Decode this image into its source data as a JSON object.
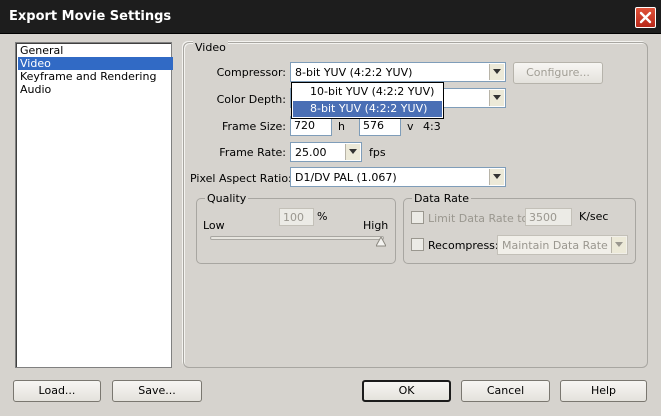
{
  "window": {
    "title": "Export Movie Settings",
    "close_icon": "close-icon"
  },
  "sidebar": {
    "items": [
      {
        "label": "General",
        "selected": false
      },
      {
        "label": "Video",
        "selected": true
      },
      {
        "label": "Keyframe and Rendering",
        "selected": false
      },
      {
        "label": "Audio",
        "selected": false
      }
    ]
  },
  "video": {
    "legend": "Video",
    "compressor": {
      "label": "Compressor:",
      "value": "8-bit YUV (4:2:2 YUV)",
      "configure_label": "Configure...",
      "options": [
        "10-bit YUV (4:2:2 YUV)",
        "8-bit YUV (4:2:2 YUV)"
      ],
      "selected_option": "8-bit YUV (4:2:2 YUV)"
    },
    "color_depth": {
      "label": "Color Depth:",
      "value": ""
    },
    "frame_size": {
      "label": "Frame Size:",
      "width": "720",
      "h_label": "h",
      "height": "576",
      "v_label": "v",
      "aspect": "4:3"
    },
    "frame_rate": {
      "label": "Frame Rate:",
      "value": "25.00",
      "unit": "fps"
    },
    "pixel_aspect": {
      "label": "Pixel Aspect Ratio:",
      "value": "D1/DV PAL (1.067)"
    },
    "quality": {
      "legend": "Quality",
      "value": "100",
      "unit": "%",
      "low": "Low",
      "high": "High",
      "level": 1.0
    },
    "data_rate": {
      "legend": "Data Rate",
      "limit_label": "Limit Data Rate to:",
      "limit_value": "3500",
      "limit_unit": "K/sec",
      "recompress_label": "Recompress:",
      "recompress_value": "Maintain Data Rate"
    }
  },
  "footer": {
    "load": "Load...",
    "save": "Save...",
    "ok": "OK",
    "cancel": "Cancel",
    "help": "Help"
  },
  "colors": {
    "titlebar": "#1d1d1d",
    "selection": "#316ac5",
    "close": "#c9361f"
  }
}
